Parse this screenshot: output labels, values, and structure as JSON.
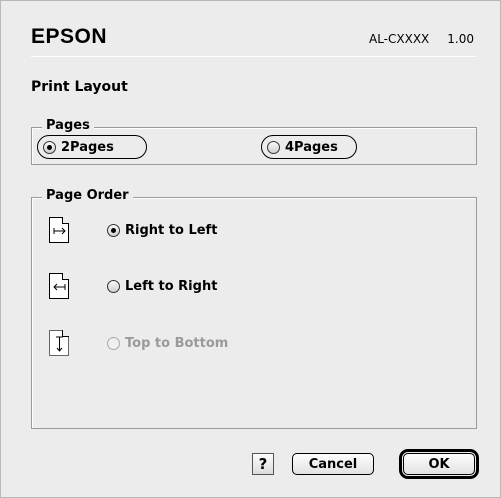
{
  "header": {
    "brand": "EPSON",
    "model": "AL-CXXXX",
    "version": "1.00"
  },
  "section_title": "Print Layout",
  "pages_group": {
    "label": "Pages",
    "options": [
      {
        "label": "2Pages",
        "checked": true
      },
      {
        "label": "4Pages",
        "checked": false
      }
    ]
  },
  "order_group": {
    "label": "Page Order",
    "options": [
      {
        "label": "Right to Left",
        "checked": true,
        "enabled": true,
        "icon": "arrow-right-icon"
      },
      {
        "label": "Left to Right",
        "checked": false,
        "enabled": true,
        "icon": "arrow-left-icon"
      },
      {
        "label": "Top to Bottom",
        "checked": false,
        "enabled": false,
        "icon": "arrow-down-icon"
      }
    ]
  },
  "buttons": {
    "help": "?",
    "cancel": "Cancel",
    "ok": "OK"
  }
}
